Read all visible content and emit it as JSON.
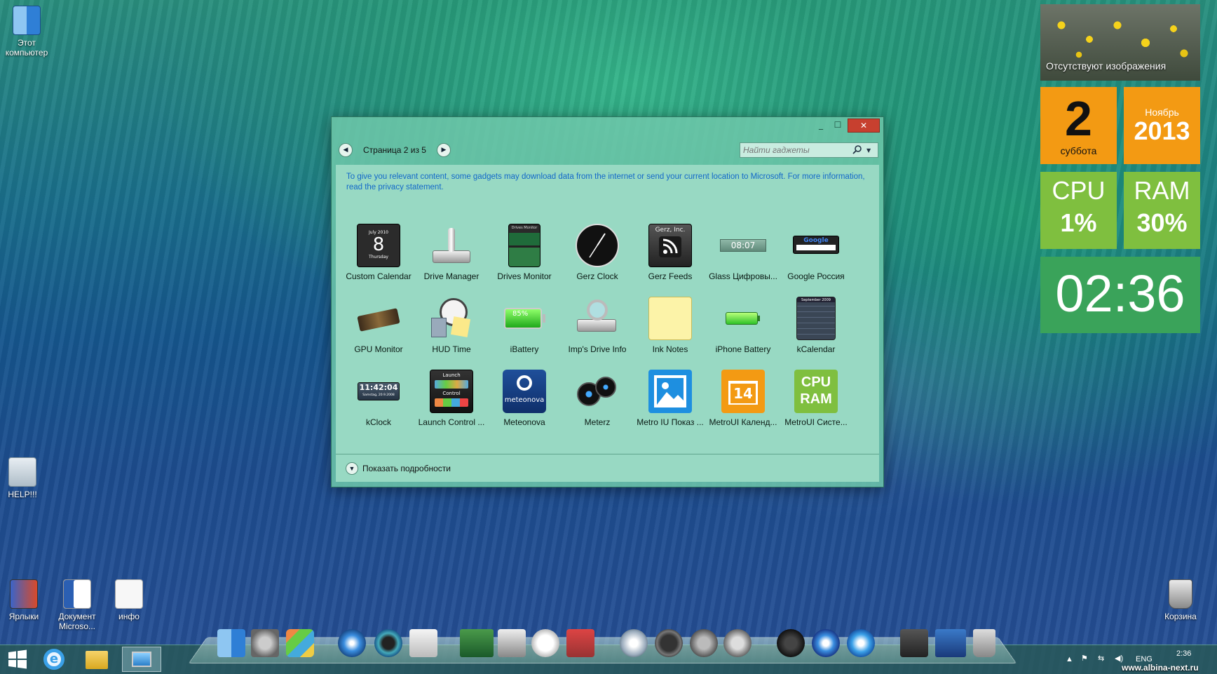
{
  "desktop": {
    "icons": [
      {
        "label": "Этот компьютер"
      },
      {
        "label": "HELP!!!"
      },
      {
        "label": "Ярлыки"
      },
      {
        "label": "Документ Microso..."
      },
      {
        "label": "инфо"
      },
      {
        "label": "Корзина"
      }
    ]
  },
  "tiles": {
    "photo_caption": "Отсутствуют изображения",
    "day_number": "2",
    "day_name": "суббота",
    "month": "Ноябрь",
    "year": "2013",
    "cpu_label": "CPU",
    "cpu_value": "1%",
    "ram_label": "RAM",
    "ram_value": "30%",
    "clock": "02:36"
  },
  "window": {
    "minimize": "_",
    "maximize": "☐",
    "close": "✕",
    "prev": "◀",
    "next": "▶",
    "page_label": "Страница 2 из 5",
    "search_placeholder": "Найти гаджеты",
    "notice": "To give you relevant content, some gadgets may download data from the internet or send your current location to Microsoft. For more information, read the privacy statement.",
    "details_label": "Показать подробности",
    "gadgets": [
      {
        "label": "Custom Calendar",
        "art": "July 2010",
        "art2": "8",
        "art3": "Thursday"
      },
      {
        "label": "Drive Manager"
      },
      {
        "label": "Drives Monitor",
        "art": "Drives Monitor"
      },
      {
        "label": "Gerz Clock"
      },
      {
        "label": "Gerz Feeds",
        "art": "Gerz, Inc."
      },
      {
        "label": "Glass Цифровы...",
        "art": "08:07"
      },
      {
        "label": "Google Россия",
        "art": "Google"
      },
      {
        "label": "GPU Monitor"
      },
      {
        "label": "HUD Time"
      },
      {
        "label": "iBattery",
        "art": "85%"
      },
      {
        "label": "Imp's Drive Info"
      },
      {
        "label": "Ink Notes"
      },
      {
        "label": "iPhone Battery"
      },
      {
        "label": "kCalendar",
        "art": "September 2009"
      },
      {
        "label": "kClock",
        "art": "11:42:04",
        "art2": "Samstag, 20.9.2008"
      },
      {
        "label": "Launch Control ...",
        "art": "Launch",
        "art2": "Control"
      },
      {
        "label": "Meteonova",
        "art": "meteonova"
      },
      {
        "label": "Meterz"
      },
      {
        "label": "Metro IU Показ ..."
      },
      {
        "label": "MetroUI Календ...",
        "art": "14"
      },
      {
        "label": "MetroUI Систе...",
        "art": "CPU",
        "art2": "RAM"
      }
    ]
  },
  "tray": {
    "lang": "ENG",
    "time": "2:36",
    "watermark": "www.albina-next.ru"
  },
  "colors": {
    "tile_orange": "#f39a13",
    "tile_green": "#7fbf3f",
    "tile_clock": "#3aa35a",
    "window_bg": "#98d9c3",
    "notice_link": "#1268c9",
    "close_red": "#c7402f"
  }
}
